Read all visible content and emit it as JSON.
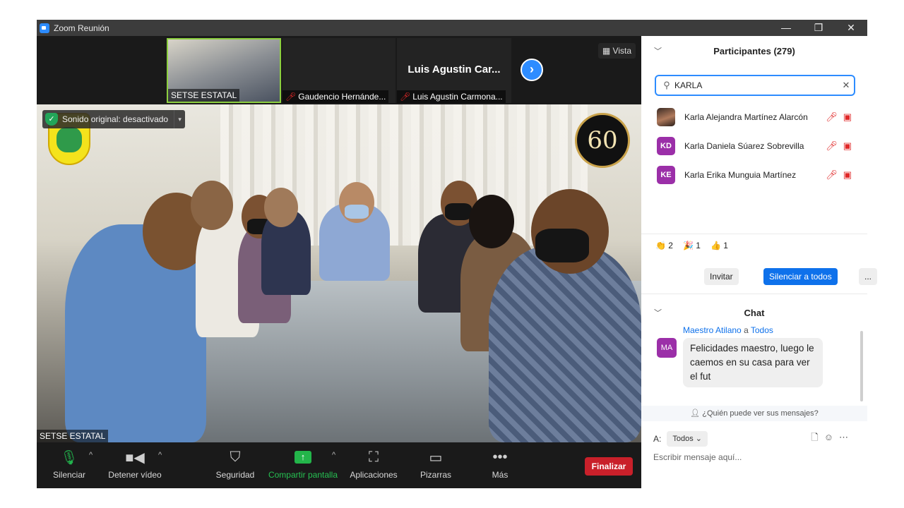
{
  "window": {
    "title": "Zoom Reunión",
    "controls": [
      "—",
      "❐",
      "✕"
    ]
  },
  "strip": {
    "thumbs": [
      {
        "name": "SETSE ESTATAL",
        "muted": false
      },
      {
        "name": "Gaudencio Hernánde...",
        "muted": true
      },
      {
        "name": "Luis Agustin Carmona...",
        "big_name": "Luis Agustin Car...",
        "muted": true
      }
    ],
    "next_icon": "›",
    "view_label": "Vista"
  },
  "main_video": {
    "audio_status": "Sonido original: desactivado",
    "label": "SETSE ESTATAL",
    "badge_text": "60"
  },
  "toolbar": {
    "mute": "Silenciar",
    "video": "Detener vídeo",
    "security": "Seguridad",
    "share": "Compartir pantalla",
    "apps": "Aplicaciones",
    "whiteboard": "Pizarras",
    "more": "Más",
    "end": "Finalizar"
  },
  "participants": {
    "header": "Participantes (279)",
    "search_value": "KARLA",
    "list": [
      {
        "initials": "",
        "name": "Karla Alejandra Martínez Alarcón",
        "photo": true
      },
      {
        "initials": "KD",
        "name": "Karla Daniela  Súarez Sobrevilla",
        "photo": false
      },
      {
        "initials": "KE",
        "name": "Karla Erika Munguia Martínez",
        "photo": false
      }
    ],
    "reactions": [
      {
        "emoji": "👏",
        "count": "2"
      },
      {
        "emoji": "🎉",
        "count": "1"
      },
      {
        "emoji": "👍",
        "count": "1"
      }
    ],
    "invite": "Invitar",
    "mute_all": "Silenciar a todos",
    "more": "..."
  },
  "chat": {
    "header": "Chat",
    "message": {
      "from": "Maestro Atilano",
      "connector": "a",
      "to": "Todos",
      "initials": "MA",
      "text": "Felicidades maestro, luego le caemos en su casa para ver el fut"
    },
    "who_can_see": "¿Quién puede ver sus mensajes?",
    "to_label": "A:",
    "to_value": "Todos",
    "placeholder": "Escribir mensaje aquí..."
  },
  "colors": {
    "accent": "#2d8cff",
    "end_red": "#c9202a",
    "share_green": "#23b54a",
    "avatar_purple": "#9b2fa8"
  }
}
